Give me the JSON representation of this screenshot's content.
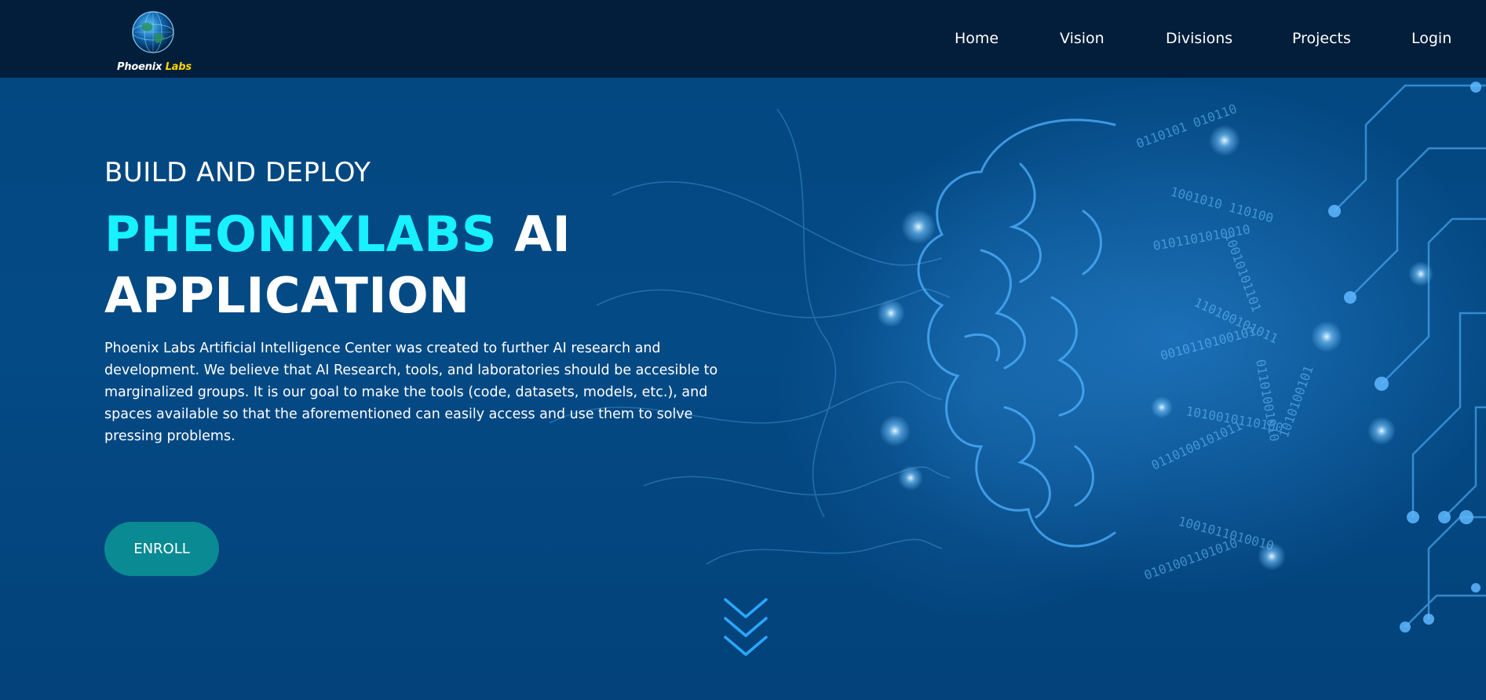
{
  "header": {
    "logo": {
      "text_main": "Phoenix",
      "text_accent": "Labs"
    },
    "nav": [
      {
        "label": "Home",
        "name": "nav-home"
      },
      {
        "label": "Vision",
        "name": "nav-vision"
      },
      {
        "label": "Divisions",
        "name": "nav-divisions"
      },
      {
        "label": "Projects",
        "name": "nav-projects"
      },
      {
        "label": "Login",
        "name": "nav-login"
      }
    ]
  },
  "hero": {
    "eyebrow": "BUILD AND DEPLOY",
    "headline_accent": "PHEONIXLABS",
    "headline_rest_1": "AI",
    "headline_rest_2": "APPLICATION",
    "description": "Phoenix Labs Artificial Intelligence Center was created to further AI research and development. We believe that AI Research, tools, and laboratories should be accesible to marginalized groups. It is our goal to make the tools (code, datasets, models, etc.), and spaces available so that the aforementioned can easily access and use them to solve pressing problems.",
    "cta_label": "ENROLL"
  },
  "icons": {
    "scroll": "chevron-down-triple-icon",
    "logo": "globe-icon",
    "art": "brain-circuit-illustration"
  },
  "colors": {
    "header_bg": "#021e3a",
    "hero_bg": "#044a85",
    "accent_cyan": "#18f1ff",
    "logo_accent": "#ffd400",
    "button_bg": "#0a8a93",
    "chevron": "#2aa7ff"
  }
}
